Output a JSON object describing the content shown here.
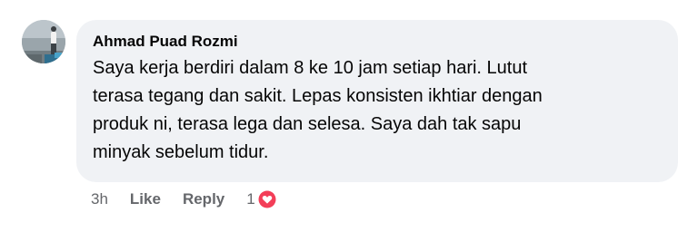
{
  "comment": {
    "author": "Ahmad Puad Rozmi",
    "text_lines": [
      "Saya kerja berdiri dalam 8 ke 10 jam setiap hari. Lutut",
      "terasa tegang dan sakit. Lepas konsisten ikhtiar dengan",
      "produk ni, terasa lega dan selesa. Saya dah tak sapu",
      "minyak sebelum tidur."
    ],
    "time": "3h",
    "like_label": "Like",
    "reply_label": "Reply",
    "reaction_count": "1",
    "reaction_icon": "heart-icon",
    "colors": {
      "bubble": "#f0f2f5",
      "text": "#050505",
      "meta": "#65676b",
      "heart": "#f33e58"
    }
  }
}
